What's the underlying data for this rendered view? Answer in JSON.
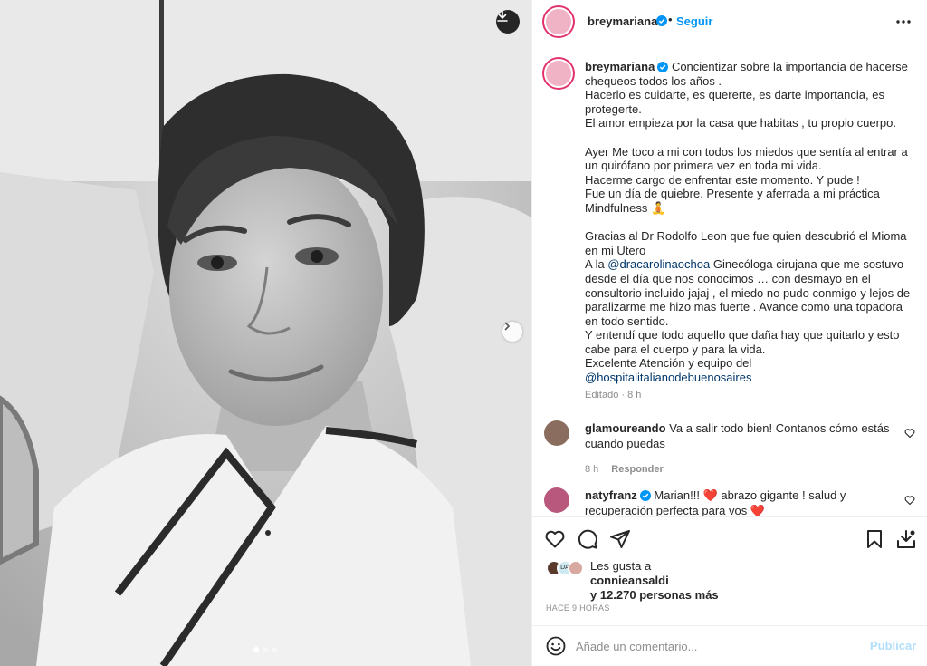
{
  "post": {
    "username": "breymariana",
    "follow_label": "Seguir",
    "bullet": "•"
  },
  "caption": {
    "username": "breymariana",
    "lines_1": [
      " Concientizar sobre la importancia de hacerse chequeos todos los años .",
      "Hacerlo es cuidarte, es quererte, es darte importancia, es protegerte.",
      "El amor empieza por la casa que habitas , tu propio cuerpo."
    ],
    "lines_2": [
      "Ayer Me toco a mi con todos los miedos que sentía al entrar a un quirófano por primera vez en toda mi vida.",
      "Hacerme cargo de enfrentar este momento. Y pude !",
      "Fue un día de quiebre. Presente y aferrada a mi práctica Mindfulness 🧘"
    ],
    "line_3": "Gracias al Dr Rodolfo Leon que fue quien descubrió el Mioma en mi Utero",
    "mention_prefix": "A la ",
    "mention_1": "@dracarolinaochoa",
    "mention_1_rest": " Ginecóloga cirujana que me sostuvo desde el día que nos conocimos … con desmayo en el consultorio incluido jajaj , el miedo no pudo conmigo y lejos de paralizarme me hizo mas fuerte . Avance como una topadora en todo sentido.",
    "line_4": "Y entendí que todo aquello que daña hay que quitarlo y esto cabe para el cuerpo y para la vida.",
    "line_5": "Excelente Atención y equipo del",
    "mention_2": "@hospitalitalianodebuenosaires",
    "meta": "Editado · 8 h"
  },
  "comments": [
    {
      "username": "glamoureando",
      "text": " Va a salir todo bien! Contanos cómo estás cuando puedas",
      "time": "8 h",
      "reply_label": "Responder"
    },
    {
      "username": "natyfranz",
      "text": " Marian!!! ❤️ abrazo gigante ! salud y recuperación perfecta para vos ❤️"
    }
  ],
  "likes": {
    "prefix": "Les gusta a",
    "user": "connieansaldi",
    "rest": "y 12.270 personas más",
    "mini_avatar_text": "DA"
  },
  "time_ago": "HACE 9 HORAS",
  "comment_box": {
    "placeholder": "Añade un comentario...",
    "publish_label": "Publicar"
  },
  "colors": {
    "accent": "#0095f6",
    "mention": "#00376b",
    "heart": "#ed4956",
    "muted": "#8e8e8e"
  },
  "icons": [
    "download-icon",
    "chevron-right-icon",
    "verified-badge-icon",
    "more-icon",
    "heart-icon",
    "comment-icon",
    "share-icon",
    "bookmark-icon",
    "emoji-icon"
  ]
}
